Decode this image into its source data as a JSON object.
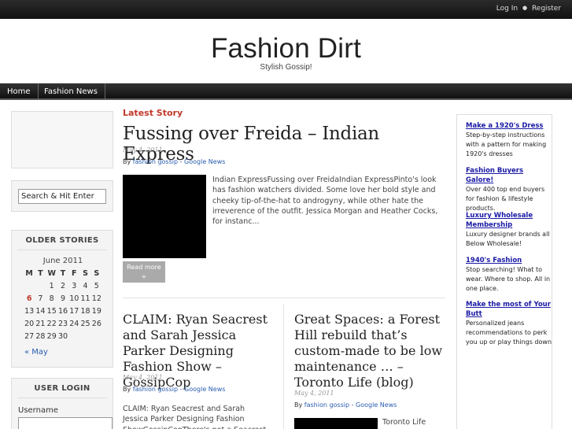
{
  "topbar": {
    "login": "Log In",
    "separator": "●",
    "register": "Register"
  },
  "header": {
    "title": "Fashion Dirt",
    "tagline": "Stylish Gossip!"
  },
  "nav": {
    "home": "Home",
    "fashion_news": "Fashion News"
  },
  "sidebar": {
    "search_placeholder": "Search & Hit Enter",
    "older_stories_title": "OLDER STORIES",
    "calendar": {
      "caption": "June 2011",
      "headers": [
        "M",
        "T",
        "W",
        "T",
        "F",
        "S",
        "S"
      ],
      "weeks": [
        [
          "",
          "",
          "1",
          "2",
          "3",
          "4",
          "5"
        ],
        [
          "6",
          "7",
          "8",
          "9",
          "10",
          "11",
          "12"
        ],
        [
          "13",
          "14",
          "15",
          "16",
          "17",
          "18",
          "19"
        ],
        [
          "20",
          "21",
          "22",
          "23",
          "24",
          "25",
          "26"
        ],
        [
          "27",
          "28",
          "29",
          "30",
          "",
          "",
          ""
        ]
      ],
      "today": "6",
      "prev_link": "« May"
    },
    "user_login_title": "USER LOGIN",
    "username_label": "Username"
  },
  "main": {
    "section_label": "Latest Story",
    "lead": {
      "title": "Fussing over Freida – Indian Express",
      "date": "May 4, 2011",
      "by_prefix": "By ",
      "author": "fashion gossip - Google News",
      "excerpt": "Indian ExpressFussing over FreidaIndian ExpressPinto's look has fashion watchers divided. Some love her bold style and cheeky tip-of-the-hat to androgyny, while other hate the irreverence of the outfit. Jessica Morgan and Heather Cocks, for instanc...",
      "read_more": "Read more",
      "read_more_icon": "+"
    },
    "posts": [
      {
        "title": "CLAIM: Ryan Seacrest and Sarah Jessica Parker Designing Fashion Show – GossipCop",
        "date": "May 4, 2011",
        "author": "fashion gossip - Google News",
        "excerpt": "CLAIM: Ryan Seacrest and Sarah Jessica Parker Designing Fashion ShowGossipCopThere's not a Seacrest-"
      },
      {
        "title": "Great Spaces: a Forest Hill rebuild that’s custom-made to be low maintenance … – Toronto Life (blog)",
        "date": "May 4, 2011",
        "author": "fashion gossip - Google News",
        "excerpt": "Toronto Life"
      }
    ]
  },
  "ads": [
    {
      "title": "Make a 1920's Dress",
      "text": "Step-by-step instructions with a pattern for making 1920's dresses"
    },
    {
      "title": "Fashion Buyers Galore!",
      "text": "Over 400 top end buyers for fashion & lifestyle products."
    },
    {
      "title": "Luxury Wholesale Membership",
      "text": "Luxury designer brands all Below Wholesale!"
    },
    {
      "title": "1940's Fashion",
      "text": "Stop searching! What to wear. Where to shop. All in one place."
    },
    {
      "title": "Make the most of Your Butt",
      "text": "Personalized jeans recommendations to perk you up or play things down"
    }
  ],
  "colors": {
    "accent_red": "#c0392b",
    "link_blue": "#2a5db0",
    "ad_title_blue": "#1a1aa6",
    "nav_bg": "#1a1a1a"
  }
}
